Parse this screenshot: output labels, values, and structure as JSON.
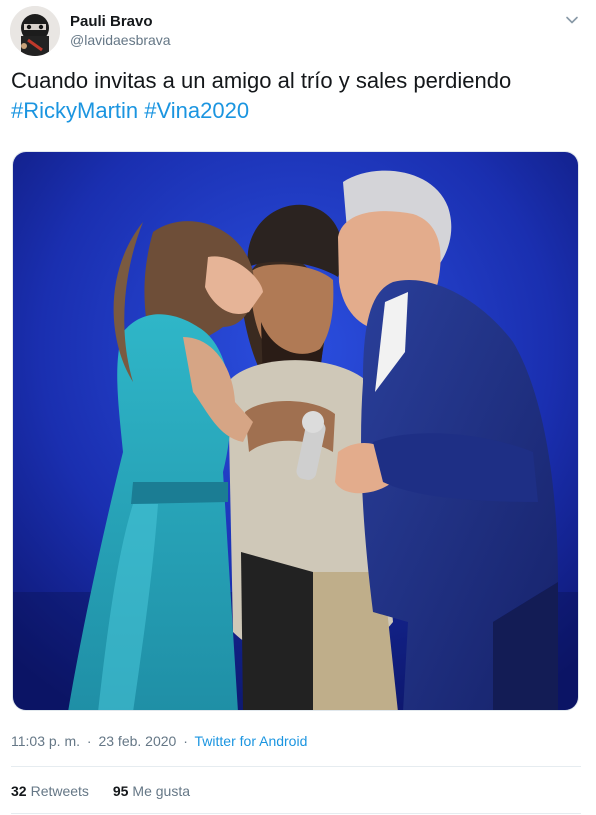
{
  "author": {
    "display_name": "Pauli Bravo",
    "handle": "@lavidaesbrava",
    "avatar_icon": "avatar-photo"
  },
  "tweet": {
    "text": "Cuando invitas a un amigo al trío y sales perdiendo",
    "hashtags": [
      "#RickyMartin",
      "#Vina2020"
    ]
  },
  "meta": {
    "time": "11:03 p. m.",
    "separator": "·",
    "date": "23 feb. 2020",
    "source": "Twitter for Android"
  },
  "stats": {
    "retweets_count": "32",
    "retweets_label": "Retweets",
    "likes_count": "95",
    "likes_label": "Me gusta"
  },
  "colors": {
    "link": "#1b95e0",
    "secondary_text": "#657786",
    "divider": "#e6ecf0",
    "photo_background": "#1a2fb0"
  },
  "icons": {
    "menu": "chevron-down-icon"
  }
}
